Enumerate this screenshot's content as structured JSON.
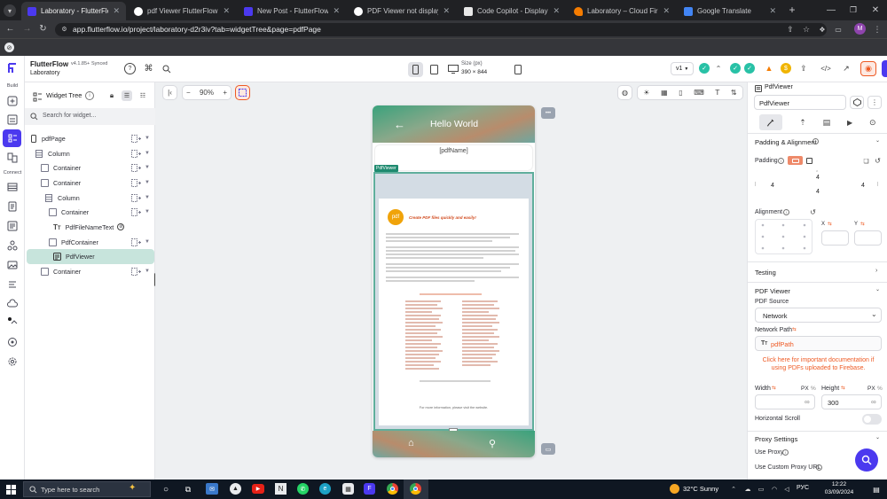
{
  "browser": {
    "tabs": [
      {
        "label": "Laboratory - FlutterFlow",
        "fav": "#4b39ef"
      },
      {
        "label": "pdf Viewer FlutterFlow - Googl",
        "fav": "#ffffff"
      },
      {
        "label": "New Post - FlutterFlow Commu",
        "fav": "#4b39ef"
      },
      {
        "label": "PDF Viewer not displaying pdf",
        "fav": "#ffffff"
      },
      {
        "label": "Code Copilot - Displaying PDF",
        "fav": "#ffffff"
      },
      {
        "label": "Laboratory – Cloud Firestore –",
        "fav": "#f57c00"
      },
      {
        "label": "Google Translate",
        "fav": "#4285f4"
      }
    ],
    "url": "app.flutterflow.io/project/laboratory-d2r3iv?tab=widgetTree&page=pdfPage"
  },
  "app": {
    "brand": "FlutterFlow",
    "version": "v4.1.85+",
    "sync_status": "Synced",
    "project": "Laboratory"
  },
  "rail": {
    "label_build": "Build",
    "label_connect": "Connect"
  },
  "toolbar": {
    "size_label": "Size (px)",
    "size_value": "390 × 844",
    "version_select": "v1",
    "zoom": "90%"
  },
  "tree": {
    "title": "Widget Tree",
    "search_placeholder": "Search for widget...",
    "nodes": [
      {
        "label": "pdfPage"
      },
      {
        "label": "Column"
      },
      {
        "label": "Container"
      },
      {
        "label": "Container"
      },
      {
        "label": "Column"
      },
      {
        "label": "Container"
      },
      {
        "label": "PdfFileNameText"
      },
      {
        "label": "PdfContainer"
      },
      {
        "label": "PdfViewer"
      },
      {
        "label": "Container"
      }
    ]
  },
  "phone": {
    "title": "Hello World",
    "pdf_name": "[pdfName]",
    "widget_tag": "PdfViewer",
    "doc_heading": "Create PDF files quickly and easily!",
    "doc_footer": "For more information, please visit the website."
  },
  "props": {
    "widget_type": "PdfViewer",
    "widget_name": "PdfViewer",
    "section_padding": "Padding & Alignment",
    "padding_label": "Padding",
    "padding_top": "4",
    "padding_left": "4",
    "padding_right": "4",
    "padding_bottom": "4",
    "alignment_label": "Alignment",
    "align_x": "X",
    "align_y": "Y",
    "section_testing": "Testing",
    "section_pdf": "PDF Viewer",
    "pdf_source_label": "PDF Source",
    "pdf_source_value": "Network",
    "network_path_label": "Network Path",
    "network_path_value": "pdfPath",
    "firebase_link": "Click here for important documentation if using PDFs uploaded to Firebase.",
    "width_label": "Width",
    "height_label": "Height",
    "unit_px": "PX",
    "unit_pct": "%",
    "height_value": "300",
    "horizontal_scroll_label": "Horizontal Scroll",
    "horizontal_scroll_on": false,
    "section_proxy": "Proxy Settings",
    "use_proxy_label": "Use Proxy",
    "use_custom_proxy_label": "Use Custom Proxy URL"
  },
  "taskbar": {
    "search_placeholder": "Type here to search",
    "weather": "32°C  Sunny",
    "lang": "РУС",
    "time": "12:22",
    "date": "03/09/2024"
  },
  "colors": {
    "accent": "#4b39ef",
    "selection": "#c7e4dc",
    "link": "#ee5a24"
  }
}
